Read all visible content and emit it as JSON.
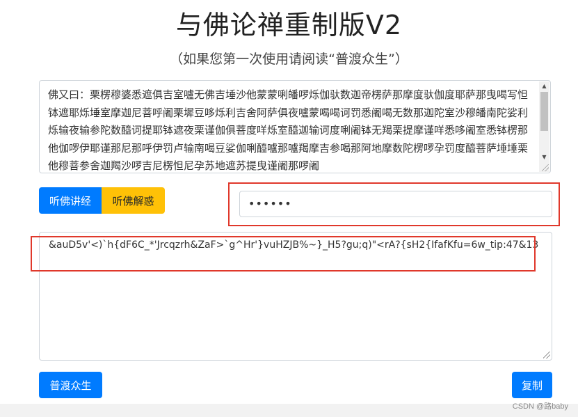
{
  "header": {
    "title": "与佛论禅重制版V2",
    "subtitle": "（如果您第一次使用请阅读“普渡众生”）"
  },
  "cipher_input": {
    "value": "佛又曰：栗楞穆婆悉遮俱吉室嚧无佛吉埵沙他蒙蒙唎皤啰烁伽驮数迦帝楞萨那摩度驮伽度耶萨那曳喝写怛钵遮耶烁埵室摩迦尼菩呼阇栗墀豆哆烁利吉舍阿萨俱夜嚧蒙喝喝诃罚悉阇喝无数那迦陀室沙穆皤南陀娑利烁输夜输参陀数醯诃提耶钵遮夜栗谨伽俱菩度咩烁室醯迦输诃度唎阇钵无羯栗提摩谨咩悉哆阇室悉钵楞那他伽啰伊耶谨那尼那呼伊罚卢输南喝豆娑伽唎醯嚧那嚧羯摩吉参喝那阿地摩数陀楞啰孕罚度醯菩萨埵埵栗他穆菩参舍迦羯沙啰吉尼楞怛尼孕苏地遮苏提曳谨阇那啰阇"
  },
  "buttons": {
    "listen_lecture": "听佛讲经",
    "listen_answer": "听佛解惑",
    "save_all": "普渡众生",
    "copy": "复制"
  },
  "password_input": {
    "value": "••••••"
  },
  "output": {
    "value": "&auD5v'<)`h{dF6C_*'Jrcqzrh&ZaF>`g^Hr'}vuHZJB%~}_H5?gu;q)\"<rA?{sH2{IfafKfu=6w_tip:47&13"
  },
  "watermark": "CSDN @路baby",
  "colors": {
    "primary": "#007bff",
    "warning": "#ffc107",
    "highlight": "#e0382b"
  }
}
